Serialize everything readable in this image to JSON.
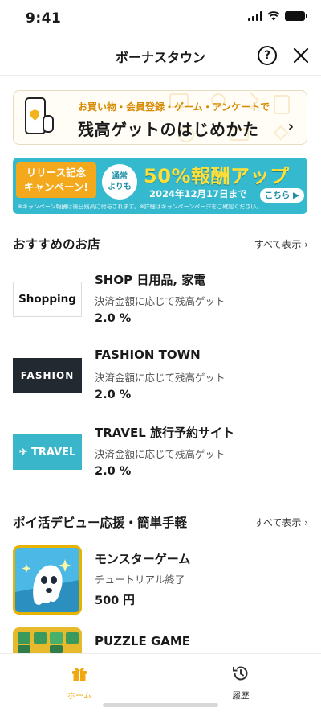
{
  "status_bar": {
    "time": "9:41"
  },
  "header": {
    "title": "ボーナスタウン",
    "help_label": "?"
  },
  "banner_guide": {
    "subtitle": "お買い物・会員登録・ゲーム・アンケートで",
    "title": "残高ゲットのはじめかた",
    "arrow": "›"
  },
  "banner_campaign": {
    "left_line1": "リリース記念",
    "left_line2": "キャンペーン!",
    "circle_line1": "通常",
    "circle_line2": "よりも",
    "headline": "50%報酬アップ",
    "date": "2024年12月17日まで",
    "button": "こちら ▶",
    "note": "※キャンペーン報酬は後日残高に付与されます。※詳細はキャンペーンページをご確認ください。"
  },
  "recommended": {
    "title": "おすすめのお店",
    "see_all": "すべて表示 ›",
    "shops": [
      {
        "logo_text": "Shopping",
        "name": "SHOP 日用品, 家電",
        "desc": "決済金額に応じて残高ゲット",
        "rate": "2.0 %"
      },
      {
        "logo_text": "FASHION",
        "name": "FASHION TOWN",
        "desc": "決済金額に応じて残高ゲット",
        "rate": "2.0 %"
      },
      {
        "logo_text": "✈ TRAVEL",
        "name": "TRAVEL 旅行予約サイト",
        "desc": "決済金額に応じて残高ゲット",
        "rate": "2.0 %"
      }
    ]
  },
  "poikatsu": {
    "title": "ポイ活デビュー応援・簡単手軽",
    "see_all": "すべて表示 ›",
    "games": [
      {
        "name": "モンスターゲーム",
        "desc": "チュートリアル終了",
        "reward": "500 円"
      },
      {
        "name": "PUZZLE GAME"
      }
    ]
  },
  "bottom_nav": {
    "items": [
      {
        "label": "ホーム",
        "icon": "gift-icon",
        "active": true
      },
      {
        "label": "履歴",
        "icon": "history-icon",
        "active": false
      }
    ]
  },
  "colors": {
    "accent": "#f0a80e",
    "banner_blue": "#35b9cf",
    "text": "#1a1a1a"
  }
}
